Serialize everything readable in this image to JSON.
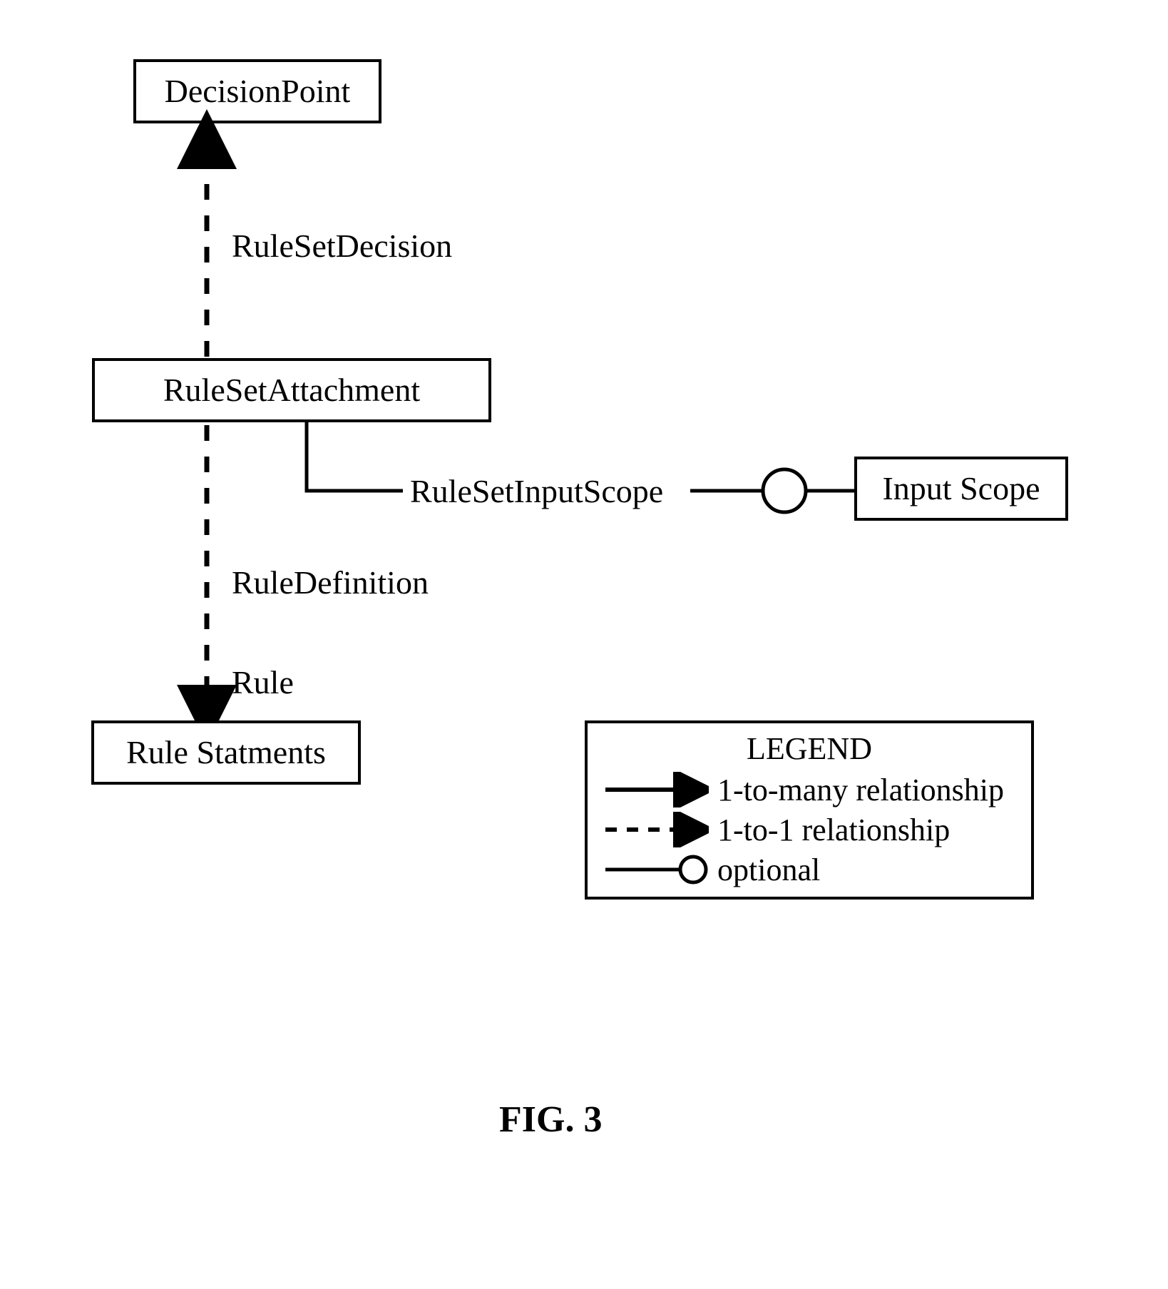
{
  "diagram": {
    "nodes": {
      "decision_point": "DecisionPoint",
      "rule_set_attachment": "RuleSetAttachment",
      "rule_statements": "Rule Statments",
      "input_scope": "Input Scope"
    },
    "edges": {
      "rule_set_decision": "RuleSetDecision",
      "rule_definition": "RuleDefinition",
      "rule": "Rule",
      "rule_set_input_scope": "RuleSetInputScope"
    },
    "legend": {
      "title": "LEGEND",
      "one_to_many": "1-to-many relationship",
      "one_to_one": "1-to-1 relationship",
      "optional": "optional"
    },
    "caption": "FIG. 3"
  }
}
